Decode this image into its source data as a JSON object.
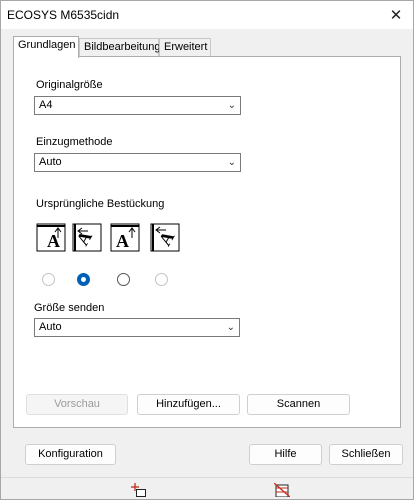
{
  "window": {
    "title": "ECOSYS M6535cidn"
  },
  "tabs": [
    {
      "label": "Grundlagen",
      "active": true
    },
    {
      "label": "Bildbearbeitung",
      "active": false
    },
    {
      "label": "Erweitert",
      "active": false
    }
  ],
  "original_size": {
    "label": "Originalgröße",
    "value": "A4"
  },
  "feed_method": {
    "label": "Einzugmethode",
    "value": "Auto"
  },
  "orientation": {
    "label": "Ursprüngliche Bestückung",
    "options": [
      {
        "icon": "orientation-upright-top-icon",
        "selected": false
      },
      {
        "icon": "orientation-left-rotated-icon",
        "selected": true
      },
      {
        "icon": "orientation-upright-alt-icon",
        "selected": false
      },
      {
        "icon": "orientation-right-rotated-icon",
        "selected": false
      }
    ]
  },
  "send_size": {
    "label": "Größe senden",
    "value": "Auto"
  },
  "actions": {
    "preview": "Vorschau",
    "add": "Hinzufügen...",
    "scan": "Scannen"
  },
  "footer": {
    "configuration": "Konfiguration",
    "help": "Hilfe",
    "close": "Schließen"
  },
  "colors": {
    "accent": "#005fb8",
    "panel": "#ffffff",
    "dialog": "#f0f0f0",
    "statusbar_icon": "#c42b1c"
  }
}
